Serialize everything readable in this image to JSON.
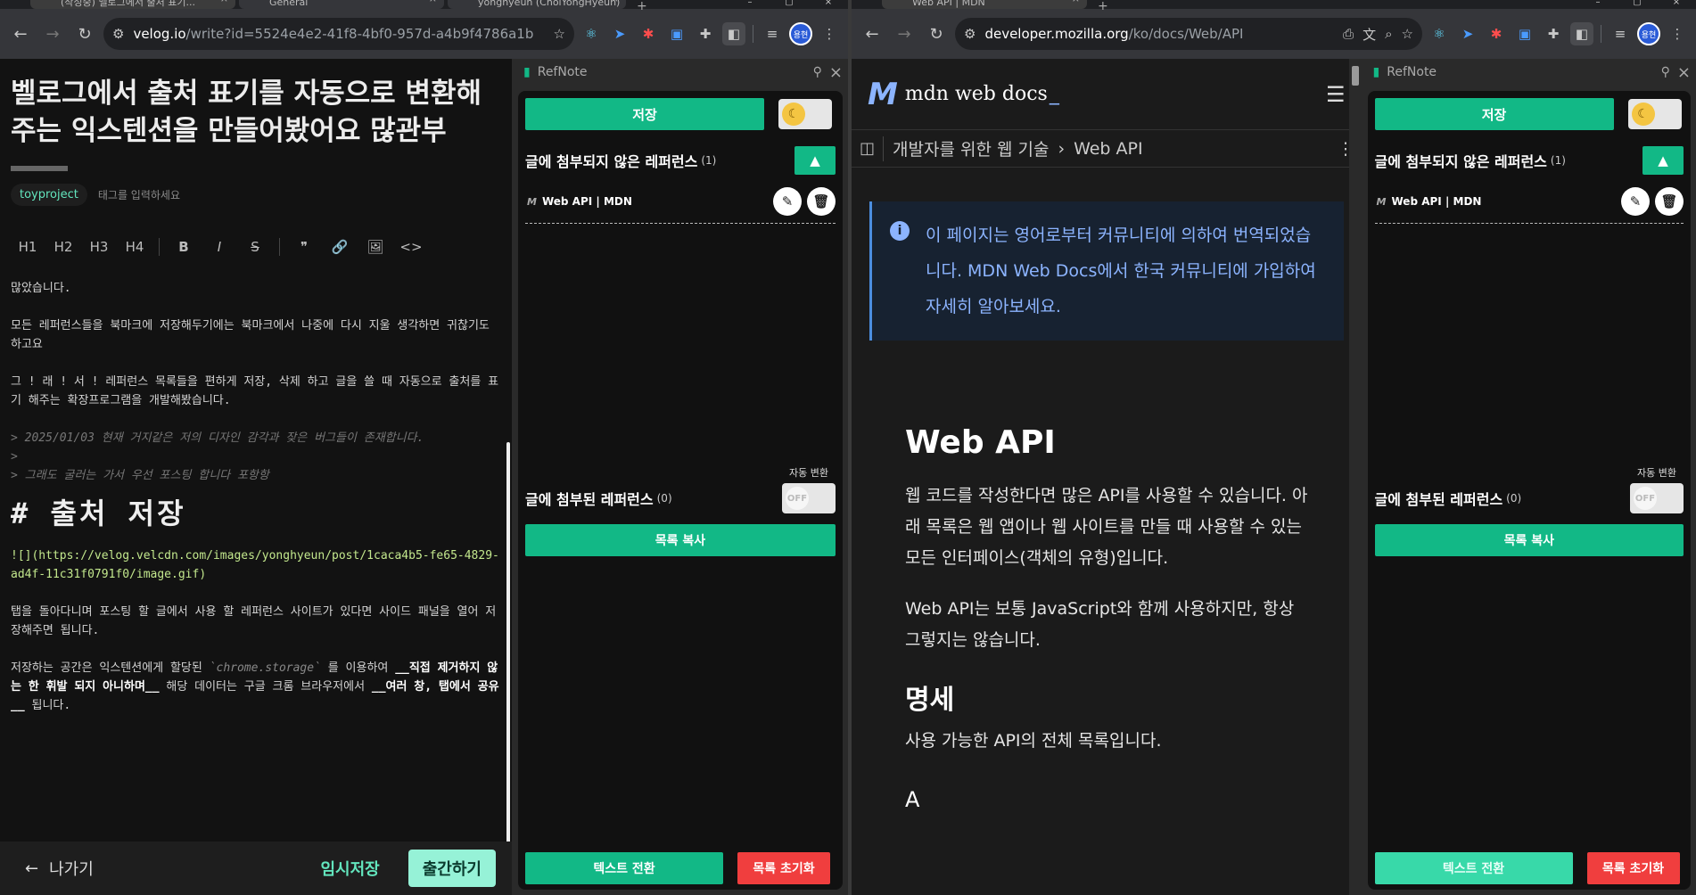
{
  "left_window": {
    "tabs": [
      {
        "label": "(작성중) 벨로그에서 출처 표기..."
      },
      {
        "label": "General"
      },
      {
        "label": "yonghyeun (ChoiYongHyeun)"
      }
    ],
    "url_host": "velog.io",
    "url_path": "/write?id=5524e4e2-41f8-4bf0-957d-a4b9f4786a1b",
    "avatar": "용현"
  },
  "right_window": {
    "tabs": [
      {
        "label": "Web API | MDN"
      }
    ],
    "url_host": "developer.mozilla.org",
    "url_path": "/ko/docs/Web/API",
    "avatar": "용현"
  },
  "editor": {
    "title": "벨로그에서 출처 표기를 자동으로 변환해주는 익스텐션을 만들어봤어요 많관부",
    "tag": "toyproject",
    "tag_placeholder": "태그를 입력하세요",
    "toolbar": [
      "H1",
      "H2",
      "H3",
      "H4",
      "B",
      "I",
      "S",
      "❞",
      "🔗",
      "🖼",
      "<>"
    ],
    "body": {
      "p1": "많았습니다.",
      "p2": "모든 레퍼런스들을 북마크에 저장해두기에는 북마크에서 나중에 다시 지울 생각하면 귀찮기도 하고요",
      "p3": "그 ! 래 ! 서 ! 레퍼런스 목록들을 편하게 저장, 삭제 하고 글을 쓸 때 자동으로 출처를 표기 해주는 확장프로그램을 개발해봤습니다.",
      "q1": "> 2025/01/03 현재 거지같은 저의 디자인 감각과 잦은 버그들이 존재합니다.",
      "q2": ">",
      "q3": "> 그래도 굴러는 가서 우선 포스팅 합니다 포항항",
      "h1": "# 출처 저장",
      "img_md": "![](https://velog.velcdn.com/images/yonghyeun/post/1caca4b5-fe65-4829-ad4f-11c31f0791f0/image.gif)",
      "p4": "탭을 돌아다니며 포스팅 할 글에서 사용 할 레퍼런스 사이트가 있다면 사이드 패널을 열어 저장해주면 됩니다.",
      "p5_a": "저장하는 공간은 익스텐션에게 할당된 ",
      "p5_code": "`chrome.storage`",
      "p5_b": " 를 이용하여 ",
      "p5_strong1": "__직접 제거하지 않는 한 휘발 되지 아니하며__",
      "p5_c": " 해당 데이터는 구글 크롬 브라우저에서 ",
      "p5_strong2": "__여러 창, 탭에서 공유__",
      "p5_d": " 됩니다."
    },
    "exit_label": "나가기",
    "draft_label": "임시저장",
    "publish_label": "출간하기"
  },
  "refnote": {
    "title": "RefNote",
    "save_label": "저장",
    "unattached_title": "글에 첨부되지 않은 레퍼런스",
    "unattached_count": "(1)",
    "item_label": "Web API | MDN",
    "attached_title": "글에 첨부된 레퍼런스",
    "attached_count": "(0)",
    "auto_convert_label": "자동 변환",
    "toggle_off_label": "OFF",
    "copy_label": "목록 복사",
    "text_convert_label": "텍스트 전환",
    "reset_label": "목록 초기화"
  },
  "mdn": {
    "logo_text": "mdn web docs",
    "breadcrumb_1": "개발자를 위한 웹 기술",
    "breadcrumb_2": "Web API",
    "notice": "이 페이지는 영어로부터 커뮤니티에 의하여 번역되었습니다. MDN Web Docs에서 한국 커뮤니티에 가입하여 자세히 알아보세요.",
    "h1": "Web API",
    "p1": "웹 코드를 작성한다면 많은 API를 사용할 수 있습니다. 아래 목록은 웹 앱이나 웹 사이트를 만들 때 사용할 수 있는 모든 인터페이스(객체의 유형)입니다.",
    "p2": "Web API는 보통 JavaScript와 함께 사용하지만, 항상 그렇지는 않습니다.",
    "h2": "명세",
    "p3": "사용 가능한 API의 전체 목록입니다.",
    "h3": "A"
  }
}
